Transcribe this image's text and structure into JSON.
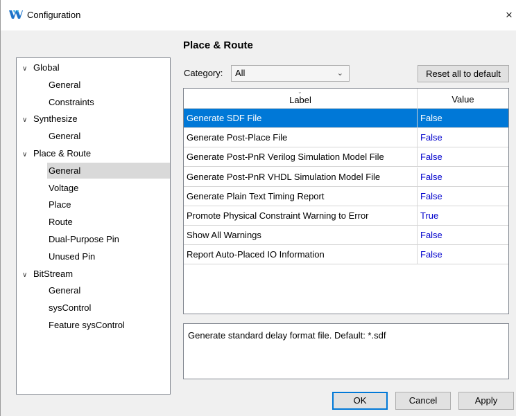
{
  "window": {
    "title": "Configuration",
    "close_glyph": "×"
  },
  "tree": {
    "items": [
      {
        "kind": "parent",
        "label": "Global",
        "expanded": true
      },
      {
        "kind": "child",
        "label": "General"
      },
      {
        "kind": "child",
        "label": "Constraints"
      },
      {
        "kind": "parent",
        "label": "Synthesize",
        "expanded": true
      },
      {
        "kind": "child",
        "label": "General"
      },
      {
        "kind": "parent",
        "label": "Place & Route",
        "expanded": true
      },
      {
        "kind": "child",
        "label": "General",
        "selected": true
      },
      {
        "kind": "child",
        "label": "Voltage"
      },
      {
        "kind": "child",
        "label": "Place"
      },
      {
        "kind": "child",
        "label": "Route"
      },
      {
        "kind": "child",
        "label": "Dual-Purpose Pin"
      },
      {
        "kind": "child",
        "label": "Unused Pin"
      },
      {
        "kind": "parent",
        "label": "BitStream",
        "expanded": true
      },
      {
        "kind": "child",
        "label": "General"
      },
      {
        "kind": "child",
        "label": "sysControl"
      },
      {
        "kind": "child",
        "label": "Feature sysControl"
      }
    ]
  },
  "main": {
    "section_title": "Place & Route",
    "category_label": "Category:",
    "category_value": "All",
    "reset_label": "Reset all to default",
    "columns": {
      "label": "Label",
      "value": "Value"
    },
    "rows": [
      {
        "label": "Generate SDF File",
        "value": "False",
        "selected": true
      },
      {
        "label": "Generate Post-Place File",
        "value": "False"
      },
      {
        "label": "Generate Post-PnR Verilog Simulation Model File",
        "value": "False"
      },
      {
        "label": "Generate Post-PnR VHDL Simulation Model File",
        "value": "False"
      },
      {
        "label": "Generate Plain Text Timing Report",
        "value": "False"
      },
      {
        "label": "Promote Physical Constraint Warning to Error",
        "value": "True"
      },
      {
        "label": "Show All Warnings",
        "value": "False"
      },
      {
        "label": "Report Auto-Placed IO Information",
        "value": "False"
      }
    ],
    "description": "Generate standard delay format file. Default: *.sdf"
  },
  "buttons": {
    "ok": "OK",
    "cancel": "Cancel",
    "apply": "Apply"
  },
  "colors": {
    "selection": "#0078d7",
    "value_text": "#0000cc",
    "tree_selection": "#d9d9d9"
  },
  "icons": {
    "app": "gowin-logo-icon",
    "expand": "chevron-down-icon",
    "dropdown": "chevron-down-icon",
    "close": "close-icon"
  }
}
